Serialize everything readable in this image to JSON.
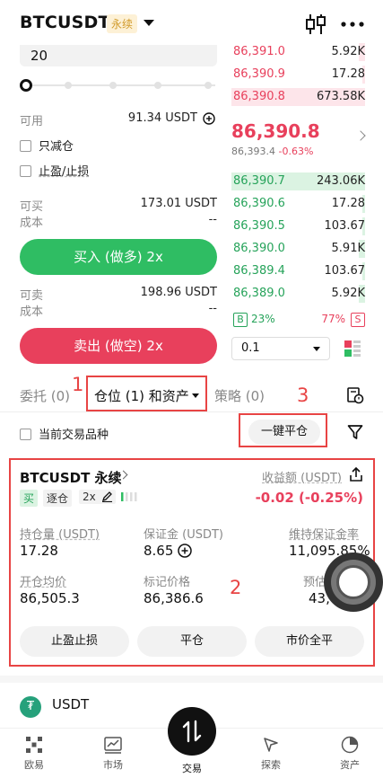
{
  "header": {
    "pair": "BTCUSDT",
    "perp_tag": "永续"
  },
  "order_form": {
    "amount_value": "20",
    "available_label": "可用",
    "available_value": "91.34 USDT",
    "reduce_only_label": "只减仓",
    "tpsl_label": "止盈/止损",
    "can_buy_label": "可买",
    "can_buy_value": "173.01 USDT",
    "cost_label": "成本",
    "cost_buy_value": "--",
    "buy_button": "买入 (做多) 2x",
    "can_sell_label": "可卖",
    "can_sell_value": "198.96 USDT",
    "cost_sell_value": "--",
    "sell_button": "卖出 (做空) 2x"
  },
  "order_book": {
    "asks": [
      {
        "price": "86,391.0",
        "qty": "5.92K",
        "depth": 0.05
      },
      {
        "price": "86,390.9",
        "qty": "17.28",
        "depth": 0.02
      },
      {
        "price": "86,390.8",
        "qty": "673.58K",
        "depth": 1.0
      }
    ],
    "last_price": "86,390.8",
    "mark_price": "86,393.4",
    "change_pct": "-0.63%",
    "bids": [
      {
        "price": "86,390.7",
        "qty": "243.06K",
        "depth": 1.0
      },
      {
        "price": "86,390.6",
        "qty": "17.28",
        "depth": 0.02
      },
      {
        "price": "86,390.5",
        "qty": "103.67",
        "depth": 0.02
      },
      {
        "price": "86,390.0",
        "qty": "5.91K",
        "depth": 0.05
      },
      {
        "price": "86,389.4",
        "qty": "103.67",
        "depth": 0.02
      },
      {
        "price": "86,389.0",
        "qty": "5.92K",
        "depth": 0.05
      }
    ],
    "buy_tag": "B",
    "buy_pct": "23%",
    "sell_pct": "77%",
    "sell_tag": "S",
    "depth_step": "0.1"
  },
  "tabs": {
    "orders": "委托 (0)",
    "positions": "仓位 (1) 和资产",
    "strategy": "策略 (0)"
  },
  "filter": {
    "current_pair_label": "当前交易品种",
    "close_all_label": "一键平仓"
  },
  "annotations": {
    "n1": "1",
    "n2": "2",
    "n3": "3"
  },
  "position": {
    "title": "BTCUSDT 永续",
    "pnl_label": "收益额 (USDT)",
    "pnl_value": "-0.02 (-0.25%)",
    "side_chip": "买",
    "margin_mode": "逐仓",
    "leverage": "2x",
    "size_label": "持仓量 (USDT)",
    "size_value": "17.28",
    "margin_label": "保证金 (USDT)",
    "margin_value": "8.65",
    "mmr_label": "维持保证金率",
    "mmr_value": "11,095.85%",
    "entry_label": "开仓均价",
    "entry_value": "86,505.3",
    "mark_label": "标记价格",
    "mark_value": "86,386.6",
    "liq_label": "预估",
    "liq_value": "43,",
    "tpsl_button": "止盈止损",
    "close_button": "平仓",
    "market_close_button": "市价全平"
  },
  "asset": {
    "name": "USDT",
    "logo_glyph": "₮"
  },
  "nav": {
    "home": "欧易",
    "market": "市场",
    "trade": "交易",
    "discover": "探索",
    "assets": "资产"
  },
  "colors": {
    "buy": "#2fbd63",
    "sell": "#e8405c",
    "annotation": "#e84444",
    "perp_tag_bg": "#fdf1d6"
  }
}
